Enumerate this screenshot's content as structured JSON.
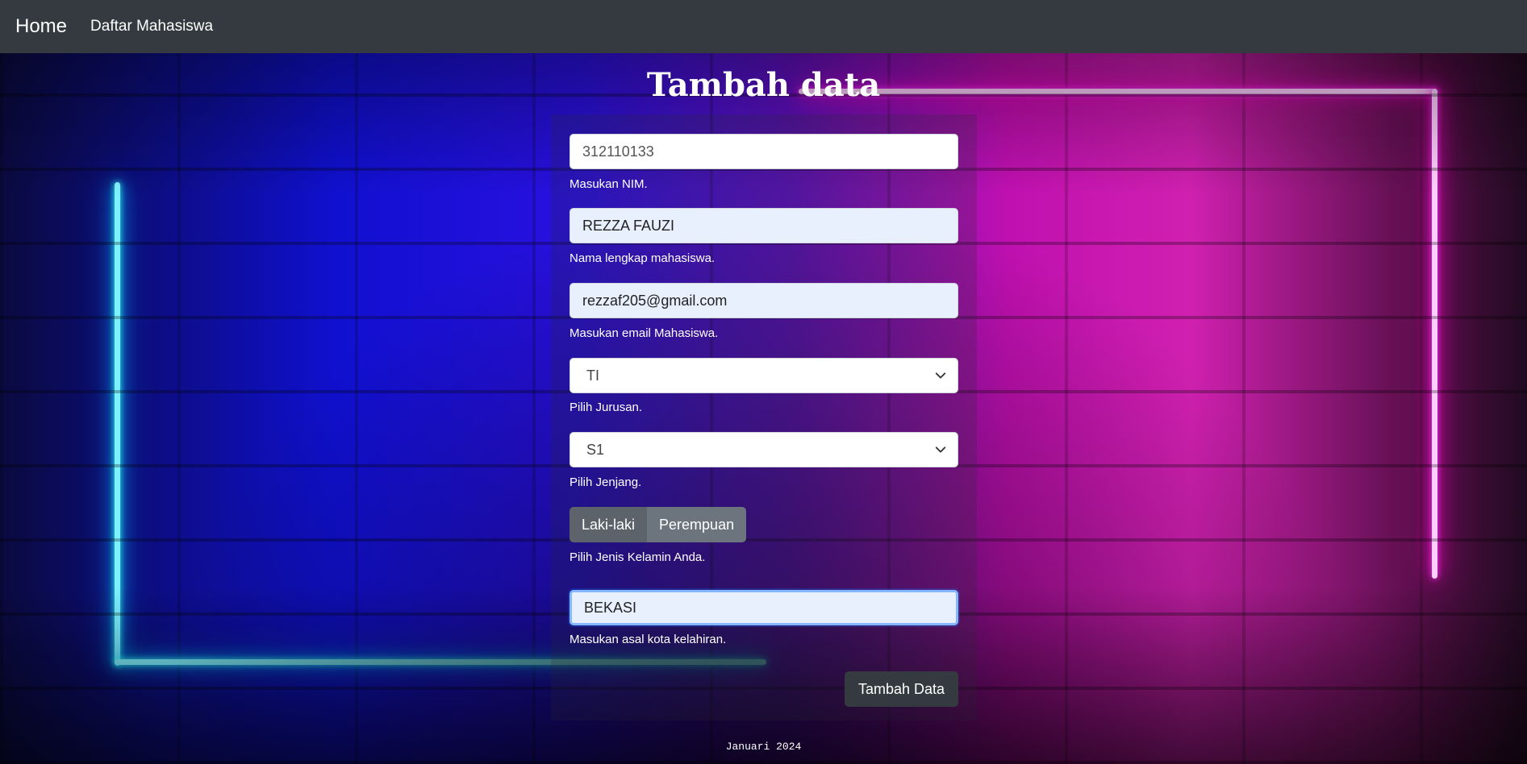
{
  "navbar": {
    "brand": "Home",
    "link": "Daftar Mahasiswa"
  },
  "page": {
    "title": "Tambah data"
  },
  "form": {
    "nim": {
      "value": "312110133",
      "help": "Masukan NIM."
    },
    "nama": {
      "value": "REZZA FAUZI",
      "help": "Nama lengkap mahasiswa."
    },
    "email": {
      "value": "rezzaf205@gmail.com",
      "help": "Masukan email Mahasiswa."
    },
    "jurusan": {
      "selected": "TI",
      "help": "Pilih Jurusan."
    },
    "jenjang": {
      "selected": "S1",
      "help": "Pilih Jenjang."
    },
    "gender": {
      "options": [
        "Laki-laki",
        "Perempuan"
      ],
      "help": "Pilih Jenis Kelamin Anda."
    },
    "kota": {
      "value": "BEKASI",
      "help": "Masukan asal kota kelahiran."
    },
    "submit_label": "Tambah Data"
  },
  "footer": {
    "text": "Januari 2024"
  },
  "colors": {
    "navbar": "#343a40",
    "neon_cyan": "#7ff0ff",
    "neon_pink": "#ffd0ff",
    "autofill": "#e8f0fe"
  }
}
